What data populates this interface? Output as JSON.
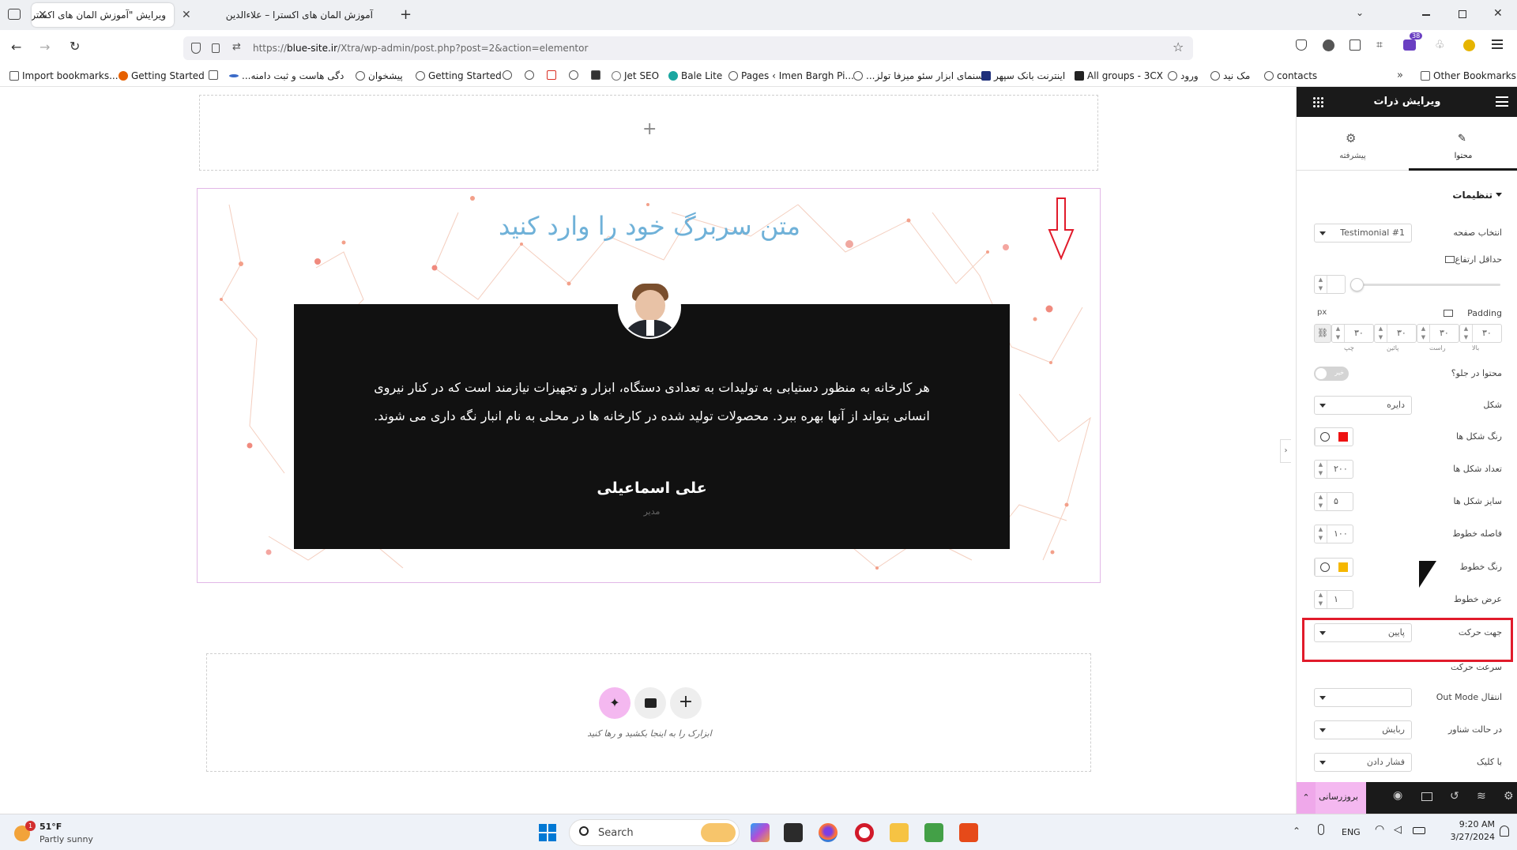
{
  "browser": {
    "tabs": [
      {
        "title": "ویرایش \"آموزش المان های اکسترا - ع"
      },
      {
        "title": "آموزش المان های اکسترا – علاءالدین"
      }
    ],
    "url": {
      "prefix": "https://",
      "domain": "blue-site.ir",
      "path": "/Xtra/wp-admin/post.php?post=2&action=elementor"
    },
    "extension_badge": "38",
    "bookmarks": [
      "Import bookmarks...",
      "Getting Started",
      "...دگی هاست و ثبت دامنه",
      "پیشخوان",
      "Getting Started",
      "Jet SEO",
      "Bale Lite",
      "Pages ‹ Imen Bargh Pi...",
      "...سنمای ابزار سئو میزفا تولز",
      "اینترنت بانک سپهر",
      "All groups - 3CX",
      "ورود",
      "مک نید",
      "contacts",
      "Other Bookmarks"
    ]
  },
  "canvas": {
    "heading": "متن سربرگ خود را وارد کنید",
    "testimonial_text": "هر کارخانه به منظور دستیابی به تولیدات به تعدادی دستگاه، ابزار و تجهیزات نیازمند است که در کنار نیروی انسانی بتواند از آنها بهره ببرد. محصولات تولید شده در کارخانه ها در محلی به نام انبار نگه داری می شوند.",
    "name": "علی اسماعیلی",
    "role": "مدیر",
    "drop_hint": "ابزارک را به اینجا بکشید و رها کنید",
    "plus": "+"
  },
  "panel": {
    "title": "ویرایش ذرات",
    "tabs": [
      {
        "label": "محتوا",
        "icon": "pencil-icon"
      },
      {
        "label": "پیشرفته",
        "icon": "gear-icon"
      }
    ],
    "section": "تنظیمات",
    "fields": {
      "page_select": {
        "label": "انتخاب صفحه",
        "value": "Testimonial #1"
      },
      "min_height": {
        "label": "حداقل ارتفاع"
      },
      "padding": {
        "label": "Padding",
        "unit": "px",
        "values": [
          "۳۰",
          "۳۰",
          "۳۰",
          "۳۰"
        ],
        "sublabels": [
          "بالا",
          "راست",
          "پائین",
          "چپ"
        ]
      },
      "content_in_column": {
        "label": "محتوا در جلو؟",
        "toggle": "خیر"
      },
      "shape": {
        "label": "شکل",
        "value": "دایره"
      },
      "shape_color": {
        "label": "رنگ شکل ها",
        "color": "#ee1111"
      },
      "shape_count": {
        "label": "تعداد شکل ها",
        "value": "۲۰۰"
      },
      "shape_size": {
        "label": "سایز شکل ها",
        "value": "۵"
      },
      "line_distance": {
        "label": "فاصله خطوط",
        "value": "۱۰۰"
      },
      "line_color": {
        "label": "رنگ خطوط",
        "color": "#f5b700"
      },
      "line_width": {
        "label": "عرض خطوط",
        "value": "۱"
      },
      "move_direction": {
        "label": "جهت حرکت",
        "value": "پایین"
      },
      "move_speed": {
        "label": "سرعت حرکت"
      },
      "out_mode": {
        "label": "انتقال Out Mode",
        "value": ""
      },
      "hover_mode": {
        "label": "در حالت شناور",
        "value": "ربایش"
      },
      "click_mode": {
        "label": "با کلیک",
        "value": "فشار دادن"
      }
    },
    "footer": {
      "update_label": "بروزرسانی"
    }
  },
  "taskbar": {
    "weather_temp": "51°F",
    "weather_desc": "Partly sunny",
    "weather_badge": "1",
    "search_label": "Search",
    "lang": "ENG",
    "time": "9:20 AM",
    "date": "3/27/2024"
  },
  "colors": {
    "heading": "#6fb1d8",
    "particles": "#f0a58e",
    "highlight_box": "#e11b2b",
    "arrow": "#e11b2b",
    "ai_button": "#f4b8f0"
  }
}
